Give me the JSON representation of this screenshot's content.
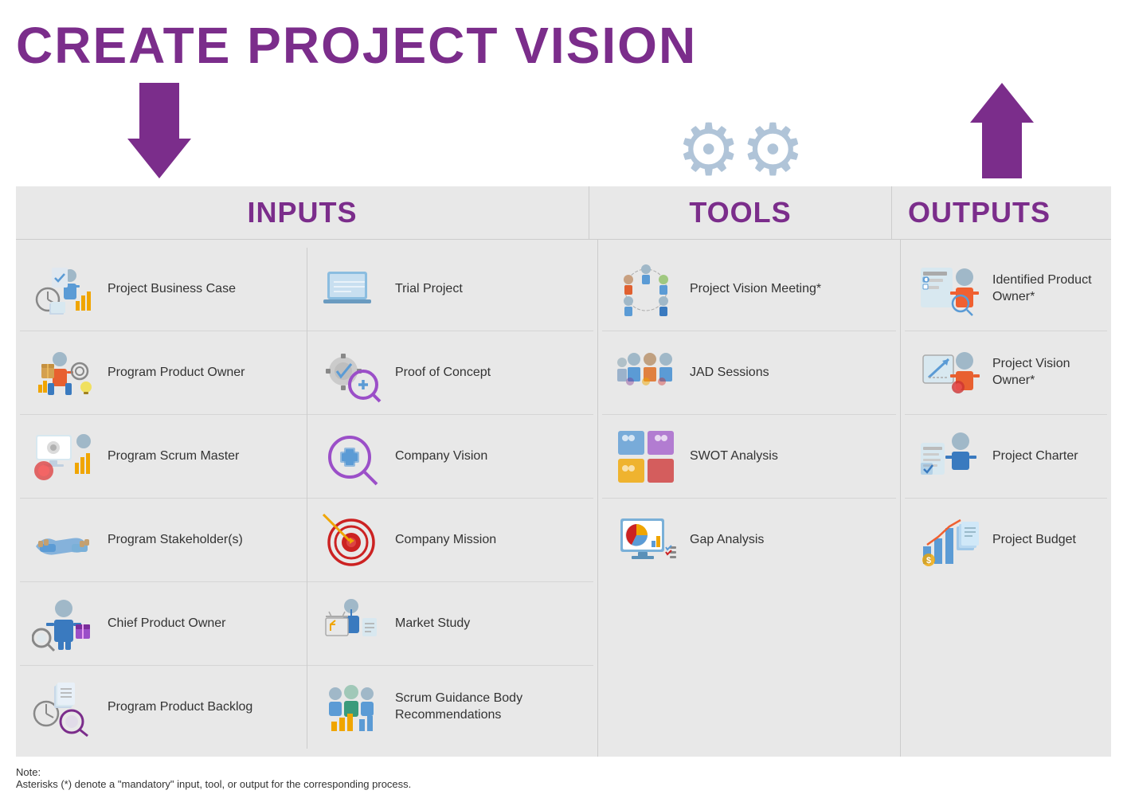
{
  "title": "CREATE PROJECT VISION",
  "sections": {
    "inputs_label": "INPUTS",
    "tools_label": "TOOLS",
    "outputs_label": "OUTPUTS"
  },
  "inputs_left": [
    {
      "label": "Project Business Case"
    },
    {
      "label": "Program Product Owner"
    },
    {
      "label": "Program Scrum Master"
    },
    {
      "label": "Program Stakeholder(s)"
    },
    {
      "label": "Chief Product Owner"
    },
    {
      "label": "Program Product Backlog"
    }
  ],
  "inputs_right": [
    {
      "label": "Trial Project"
    },
    {
      "label": "Proof of Concept"
    },
    {
      "label": "Company Vision"
    },
    {
      "label": "Company Mission"
    },
    {
      "label": "Market Study"
    },
    {
      "label": "Scrum Guidance Body\nRecommendations"
    }
  ],
  "tools": [
    {
      "label": "Project Vision Meeting*"
    },
    {
      "label": "JAD Sessions"
    },
    {
      "label": "SWOT Analysis"
    },
    {
      "label": "Gap Analysis"
    }
  ],
  "outputs": [
    {
      "label": "Identified Product Owner*"
    },
    {
      "label": "Project Vision Owner*"
    },
    {
      "label": "Project Charter"
    },
    {
      "label": "Project Budget"
    }
  ],
  "note": "Note:\nAsterisks (*) denote a \"mandatory\" input, tool, or output for the corresponding process."
}
